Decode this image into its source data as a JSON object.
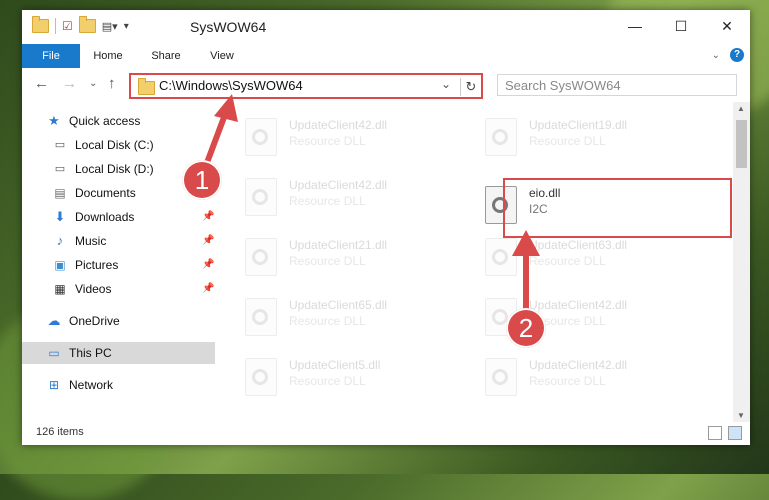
{
  "window": {
    "title": "SysWOW64",
    "controls": {
      "minimize": "—",
      "maximize": "☐",
      "close": "✕"
    }
  },
  "ribbon": {
    "tabs": [
      "File",
      "Home",
      "Share",
      "View"
    ]
  },
  "address": {
    "path": "C:\\Windows\\SysWOW64",
    "search_placeholder": "Search SysWOW64"
  },
  "nav": {
    "items": [
      {
        "label": "Quick access",
        "icon": "star-icon"
      },
      {
        "label": "Local Disk (C:)",
        "icon": "drive-icon"
      },
      {
        "label": "Local Disk (D:)",
        "icon": "drive-icon"
      },
      {
        "label": "Documents",
        "icon": "documents-icon"
      },
      {
        "label": "Downloads",
        "icon": "download-icon"
      },
      {
        "label": "Music",
        "icon": "music-icon"
      },
      {
        "label": "Pictures",
        "icon": "pictures-icon"
      },
      {
        "label": "Videos",
        "icon": "videos-icon"
      },
      {
        "label": "OneDrive",
        "icon": "cloud-icon"
      },
      {
        "label": "This PC",
        "icon": "computer-icon"
      },
      {
        "label": "Network",
        "icon": "network-icon"
      }
    ]
  },
  "files": [
    {
      "name": "UpdateClient42.dll",
      "desc": "Resource DLL"
    },
    {
      "name": "UpdateClient19.dll",
      "desc": "Resource DLL"
    },
    {
      "name": "UpdateClient42.dll",
      "desc": "Resource DLL"
    },
    {
      "name": "UpdateClient21.dll",
      "desc": "Resource DLL"
    },
    {
      "name": "UpdateClient63.dll",
      "desc": "Resource DLL"
    },
    {
      "name": "UpdateClient65.dll",
      "desc": "Resource DLL"
    },
    {
      "name": "UpdateClient42.dll",
      "desc": "Resource DLL"
    },
    {
      "name": "UpdateClient5.dll",
      "desc": "Resource DLL"
    },
    {
      "name": "UpdateClient42.dll",
      "desc": "Resource DLL"
    }
  ],
  "highlight_file": {
    "name": "eio.dll",
    "desc": "I2C"
  },
  "status": {
    "count": "126 items"
  },
  "callouts": [
    "1",
    "2"
  ],
  "colors": {
    "accent": "#1979ca",
    "highlight": "#d94a4a"
  }
}
